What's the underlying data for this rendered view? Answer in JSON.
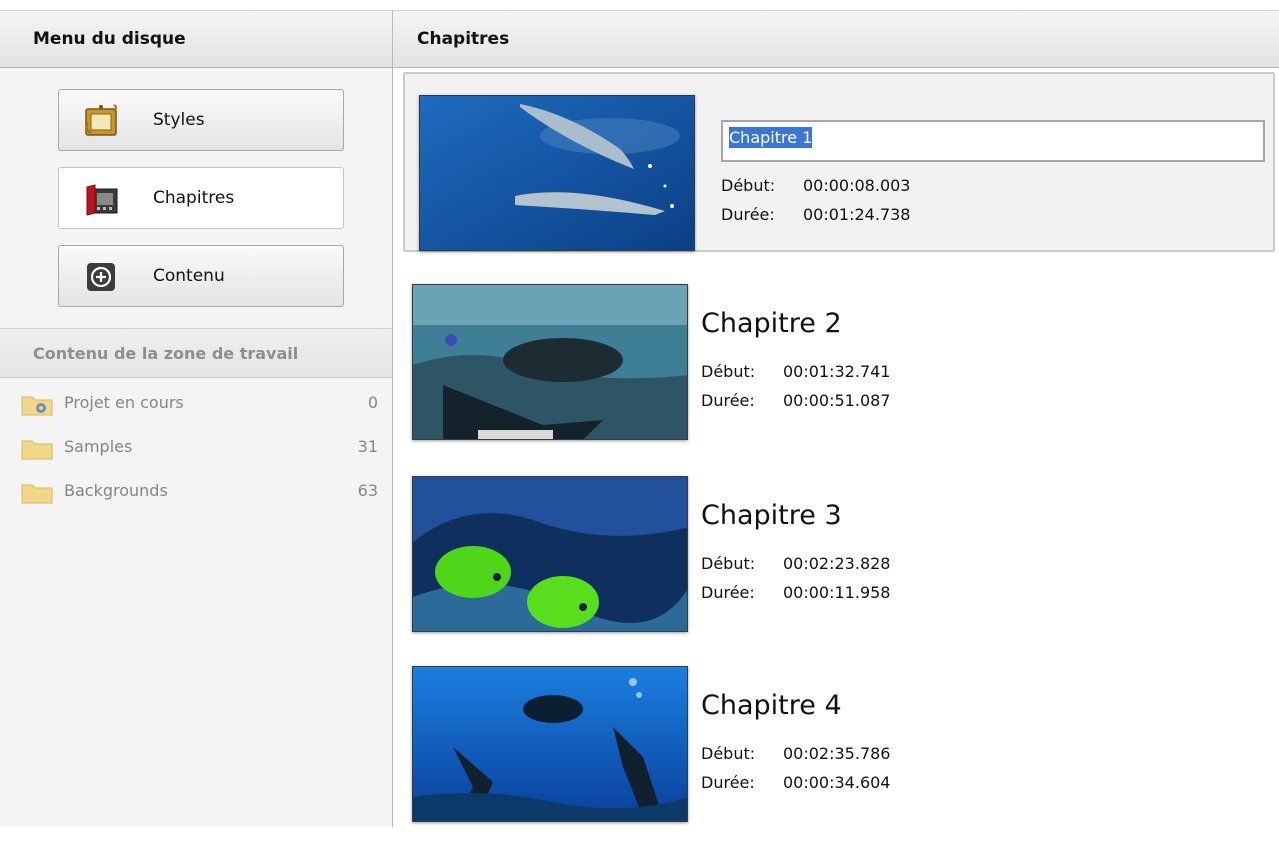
{
  "left_panel": {
    "header": "Menu du disque",
    "buttons": [
      {
        "label": "Styles",
        "icon": "picture-frame-icon"
      },
      {
        "label": "Chapitres",
        "icon": "film-chapters-icon"
      },
      {
        "label": "Contenu",
        "icon": "add-circle-icon"
      }
    ],
    "workspace": {
      "header": "Contenu de la zone de travail",
      "items": [
        {
          "label": "Projet en cours",
          "count": "0",
          "icon": "gear-folder-icon"
        },
        {
          "label": "Samples",
          "count": "31",
          "icon": "folder-icon"
        },
        {
          "label": "Backgrounds",
          "count": "63",
          "icon": "folder-icon"
        }
      ]
    }
  },
  "right_panel": {
    "header": "Chapitres",
    "start_label": "Début:",
    "duration_label": "Durée:",
    "chapters": [
      {
        "name": "Chapitre 1",
        "start": "00:00:08.003",
        "duration": "00:01:24.738",
        "selected": true
      },
      {
        "name": "Chapitre 2",
        "start": "00:01:32.741",
        "duration": "00:00:51.087"
      },
      {
        "name": "Chapitre 3",
        "start": "00:02:23.828",
        "duration": "00:00:11.958"
      },
      {
        "name": "Chapitre 4",
        "start": "00:02:35.786",
        "duration": "00:00:34.604"
      }
    ]
  },
  "colors": {
    "selection_highlight": "#3a76d6",
    "panel_background": "#f4f4f4",
    "muted_text": "#858585"
  }
}
